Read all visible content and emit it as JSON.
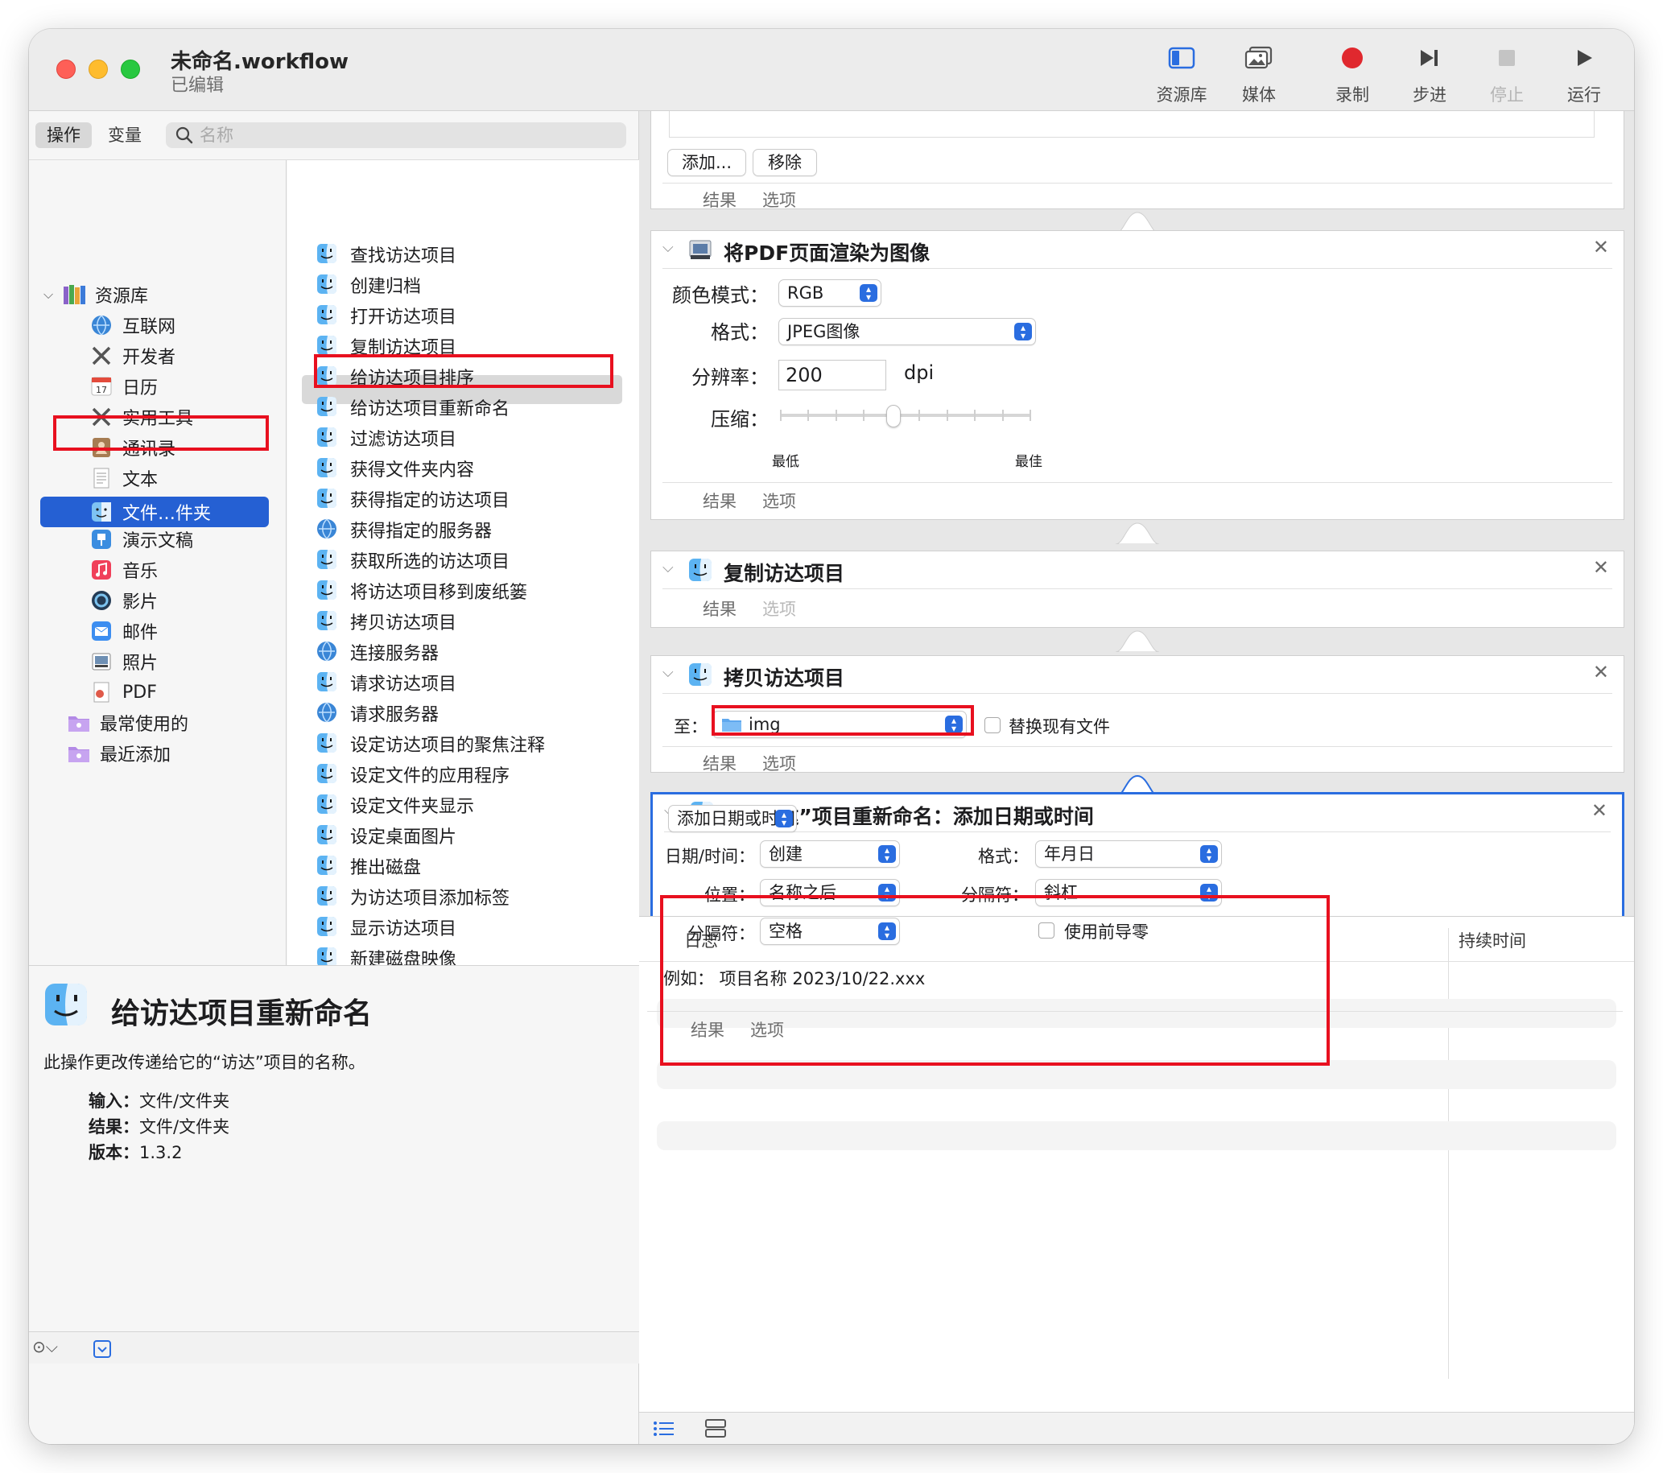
{
  "window": {
    "title": "未命名.workflow",
    "subtitle": "已编辑"
  },
  "toolbar": {
    "library": "资源库",
    "media": "媒体",
    "record": "录制",
    "step": "步进",
    "stop": "停止",
    "run": "运行"
  },
  "left": {
    "tab_actions": "操作",
    "tab_variables": "变量",
    "search_placeholder": "名称",
    "library_items": [
      "资源库",
      "互联网",
      "开发者",
      "日历",
      "实用工具",
      "通讯录",
      "文本",
      "文件…件夹",
      "演示文稿",
      "音乐",
      "影片",
      "邮件",
      "照片",
      "PDF",
      "最常使用的",
      "最近添加"
    ],
    "calendar_day": "17",
    "actions": [
      "查找访达项目",
      "创建归档",
      "打开访达项目",
      "复制访达项目",
      "给访达项目排序",
      "给访达项目重新命名",
      "过滤访达项目",
      "获得文件夹内容",
      "获得指定的访达项目",
      "获得指定的服务器",
      "获取所选的访达项目",
      "将访达项目移到废纸篓",
      "拷贝访达项目",
      "连接服务器",
      "请求访达项目",
      "请求服务器",
      "设定访达项目的聚焦注释",
      "设定文件的应用程序",
      "设定文件夹显示",
      "设定桌面图片",
      "推出磁盘",
      "为访达项目添加标签",
      "显示访达项目",
      "新建磁盘映像",
      "新建替身",
      "新建文件夹",
      "移动访达项目",
      "装载磁盘映像"
    ],
    "description": {
      "title": "给访达项目重新命名",
      "text": "此操作更改传递给它的“访达”项目的名称。",
      "input_label": "输入：",
      "input_value": "文件/文件夹",
      "result_label": "结果：",
      "result_value": "文件/文件夹",
      "version_label": "版本：",
      "version_value": "1.3.2"
    }
  },
  "workflow": {
    "tab_results": "结果",
    "tab_options": "选项",
    "card0": {
      "add": "添加...",
      "remove": "移除"
    },
    "pdf_card": {
      "title": "将PDF页面渲染为图像",
      "color_mode_label": "颜色模式：",
      "color_mode": "RGB",
      "format_label": "格式：",
      "format": "JPEG图像",
      "resolution_label": "分辨率：",
      "resolution": "200",
      "resolution_unit": "dpi",
      "compression_label": "压缩：",
      "compression_min": "最低",
      "compression_max": "最佳",
      "compression_value": 0.45
    },
    "copy_card": {
      "title": "复制访达项目"
    },
    "copyto_card": {
      "title": "拷贝访达项目",
      "to_label": "至：",
      "to_value": "img",
      "replace_label": "替换现有文件"
    },
    "rename_card": {
      "title": "给“访达”项目重新命名：添加日期或时间",
      "mode": "添加日期或时间",
      "datetime_label": "日期/时间：",
      "datetime": "创建",
      "position_label": "位置：",
      "position": "名称之后",
      "separator_label": "分隔符：",
      "separator": "空格",
      "format_label": "格式：",
      "format": "年月日",
      "separator2_label": "分隔符：",
      "separator2": "斜杠",
      "leading_zero_label": "使用前导零",
      "example": "例如：  项目名称 2023/10/22.xxx"
    }
  },
  "log": {
    "col_log": "日志",
    "col_duration": "持续时间"
  },
  "colors": {
    "accent": "#2560d3",
    "highlight_red": "#e8101f",
    "record_red": "#e0282e"
  }
}
